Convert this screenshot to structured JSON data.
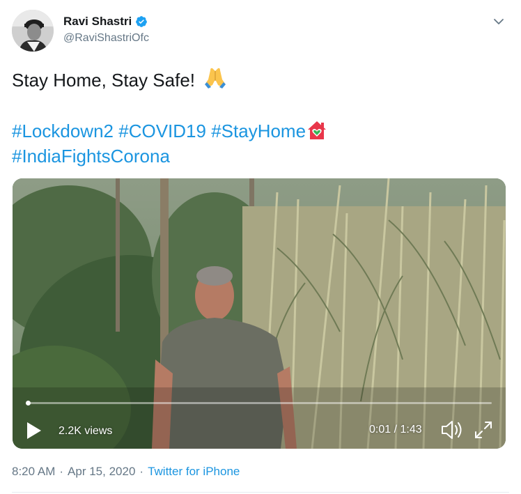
{
  "author": {
    "display_name": "Ravi Shastri",
    "handle": "@RaviShastriOfc",
    "verified": true
  },
  "tweet": {
    "text": "Stay Home, Stay Safe!",
    "hashtags": [
      "#Lockdown2",
      "#COVID19",
      "#StayHome",
      "#IndiaFightsCorona"
    ]
  },
  "video": {
    "views": "2.2K views",
    "time": "0:01 / 1:43",
    "progress_fraction": 0.004
  },
  "footer": {
    "time": "8:20 AM",
    "date": "Apr 15, 2020",
    "separator": "·",
    "source": "Twitter for iPhone"
  },
  "icons": [
    "verified-badge-icon",
    "chevron-down-icon",
    "folded-hands-emoji",
    "house-heart-emoji",
    "play-icon",
    "volume-icon",
    "fullscreen-icon"
  ],
  "colors": {
    "link": "#1b95e0",
    "secondary_text": "#657786",
    "verified": "#1da1f2"
  }
}
